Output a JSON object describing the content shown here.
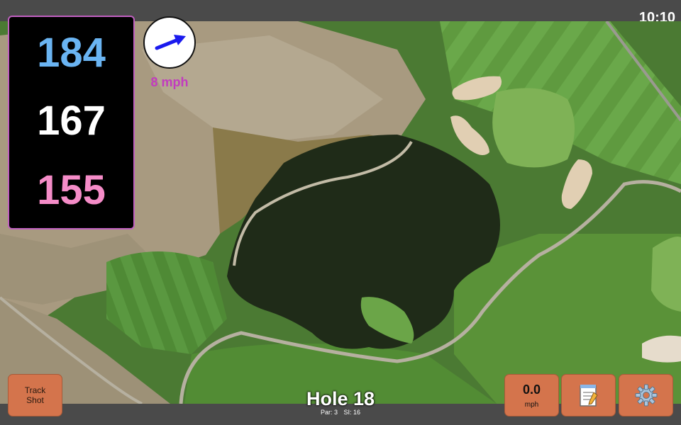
{
  "clock": "10:10",
  "distances": {
    "back": "184",
    "middle": "167",
    "front": "155",
    "back_color": "#6ab4f2",
    "middle_color": "#ffffff",
    "front_color": "#f58cc8"
  },
  "wind": {
    "speed_label": "8 mph",
    "speed_color": "#c23bbf",
    "arrow_icon": "wind-direction-arrow",
    "arrow_color": "#1a1aee"
  },
  "buttons": {
    "track_shot": "Track Shot",
    "speed_value": "0.0",
    "speed_unit": "mph",
    "notes_icon": "notepad-icon",
    "settings_icon": "gear-icon",
    "button_color": "#d4744c"
  },
  "hole": {
    "title": "Hole 18",
    "par": "Par: 3",
    "stroke_index": "SI: 16"
  }
}
